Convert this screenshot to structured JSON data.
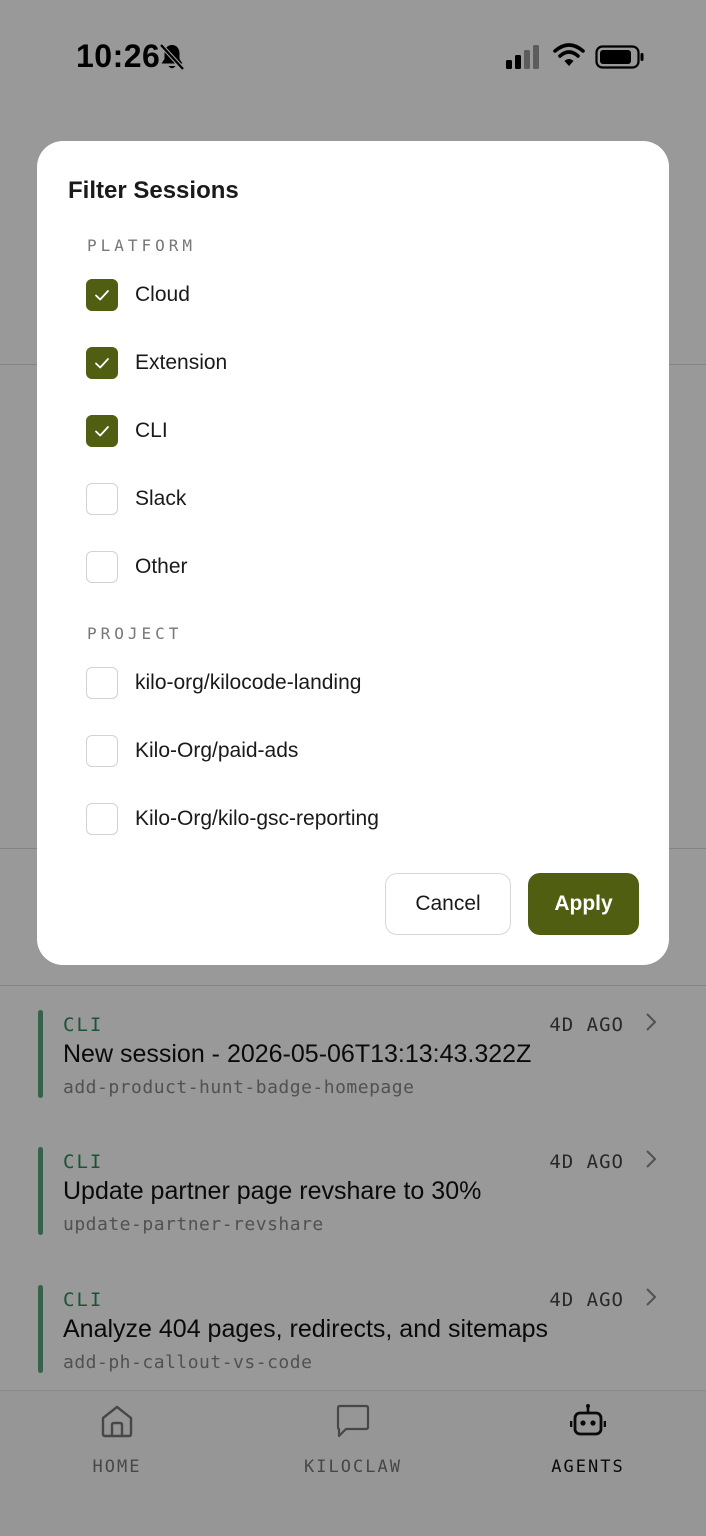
{
  "status_bar": {
    "time": "10:26",
    "icons": [
      "bell-slash-icon",
      "cellular-signal-icon",
      "wifi-icon",
      "battery-icon"
    ]
  },
  "sessions": [
    {
      "platform": "CLI",
      "ago": "4D AGO",
      "title": "New session - 2026-05-06T13:13:43.322Z",
      "branch": "add-product-hunt-badge-homepage"
    },
    {
      "platform": "CLI",
      "ago": "4D AGO",
      "title": "Update partner page revshare to 30%",
      "branch": "update-partner-revshare"
    },
    {
      "platform": "CLI",
      "ago": "4D AGO",
      "title": "Analyze 404 pages, redirects, and sitemaps",
      "branch": "add-ph-callout-vs-code"
    }
  ],
  "tabbar": {
    "tabs": [
      {
        "label": "HOME",
        "icon": "home-icon",
        "active": false
      },
      {
        "label": "KILOCLAW",
        "icon": "chat-bubble-icon",
        "active": false
      },
      {
        "label": "AGENTS",
        "icon": "robot-icon",
        "active": true
      }
    ]
  },
  "modal": {
    "title": "Filter Sessions",
    "platform_label": "PLATFORM",
    "platforms": [
      {
        "label": "Cloud",
        "checked": true
      },
      {
        "label": "Extension",
        "checked": true
      },
      {
        "label": "CLI",
        "checked": true
      },
      {
        "label": "Slack",
        "checked": false
      },
      {
        "label": "Other",
        "checked": false
      }
    ],
    "project_label": "PROJECT",
    "projects": [
      {
        "label": "kilo-org/kilocode-landing",
        "checked": false
      },
      {
        "label": "Kilo-Org/paid-ads",
        "checked": false
      },
      {
        "label": "Kilo-Org/kilo-gsc-reporting",
        "checked": false
      }
    ],
    "cancel_label": "Cancel",
    "apply_label": "Apply"
  },
  "colors": {
    "accent": "#4f5e10",
    "session_bar": "#5aa37e",
    "platform_text": "#2e8b57",
    "overlay": "rgba(0,0,0,0.40)"
  }
}
